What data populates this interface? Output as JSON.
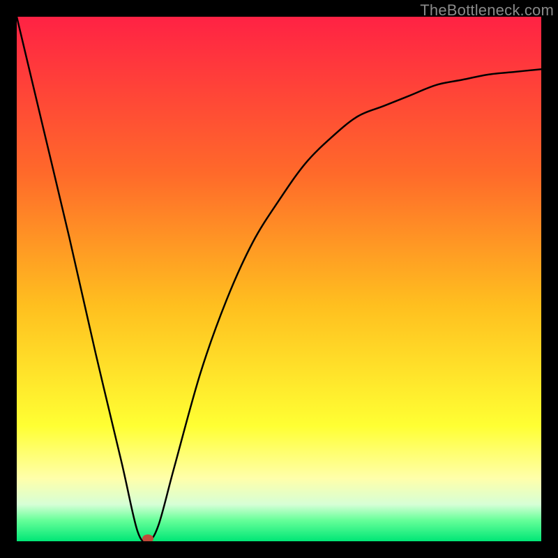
{
  "watermark": "TheBottleneck.com",
  "chart_data": {
    "type": "line",
    "title": "",
    "xlabel": "",
    "ylabel": "",
    "xlim": [
      0,
      100
    ],
    "ylim": [
      0,
      100
    ],
    "x": [
      0,
      5,
      10,
      15,
      20,
      23,
      25,
      27,
      30,
      35,
      40,
      45,
      50,
      55,
      60,
      65,
      70,
      75,
      80,
      85,
      90,
      95,
      100
    ],
    "values": [
      100,
      79,
      58,
      36,
      15,
      2,
      0,
      3,
      14,
      32,
      46,
      57,
      65,
      72,
      77,
      81,
      83,
      85,
      87,
      88,
      89,
      89.5,
      90
    ],
    "annotations": [
      {
        "label": "marker",
        "x": 25,
        "y": 0.5
      }
    ],
    "background_gradient": {
      "stops": [
        {
          "offset": 0.0,
          "color": "#ff2244"
        },
        {
          "offset": 0.3,
          "color": "#ff6a2a"
        },
        {
          "offset": 0.55,
          "color": "#ffbf1f"
        },
        {
          "offset": 0.78,
          "color": "#ffff33"
        },
        {
          "offset": 0.88,
          "color": "#ffffaa"
        },
        {
          "offset": 0.93,
          "color": "#d6ffd6"
        },
        {
          "offset": 0.96,
          "color": "#66ff99"
        },
        {
          "offset": 1.0,
          "color": "#00e676"
        }
      ]
    },
    "marker_color": "#c04a3a"
  }
}
